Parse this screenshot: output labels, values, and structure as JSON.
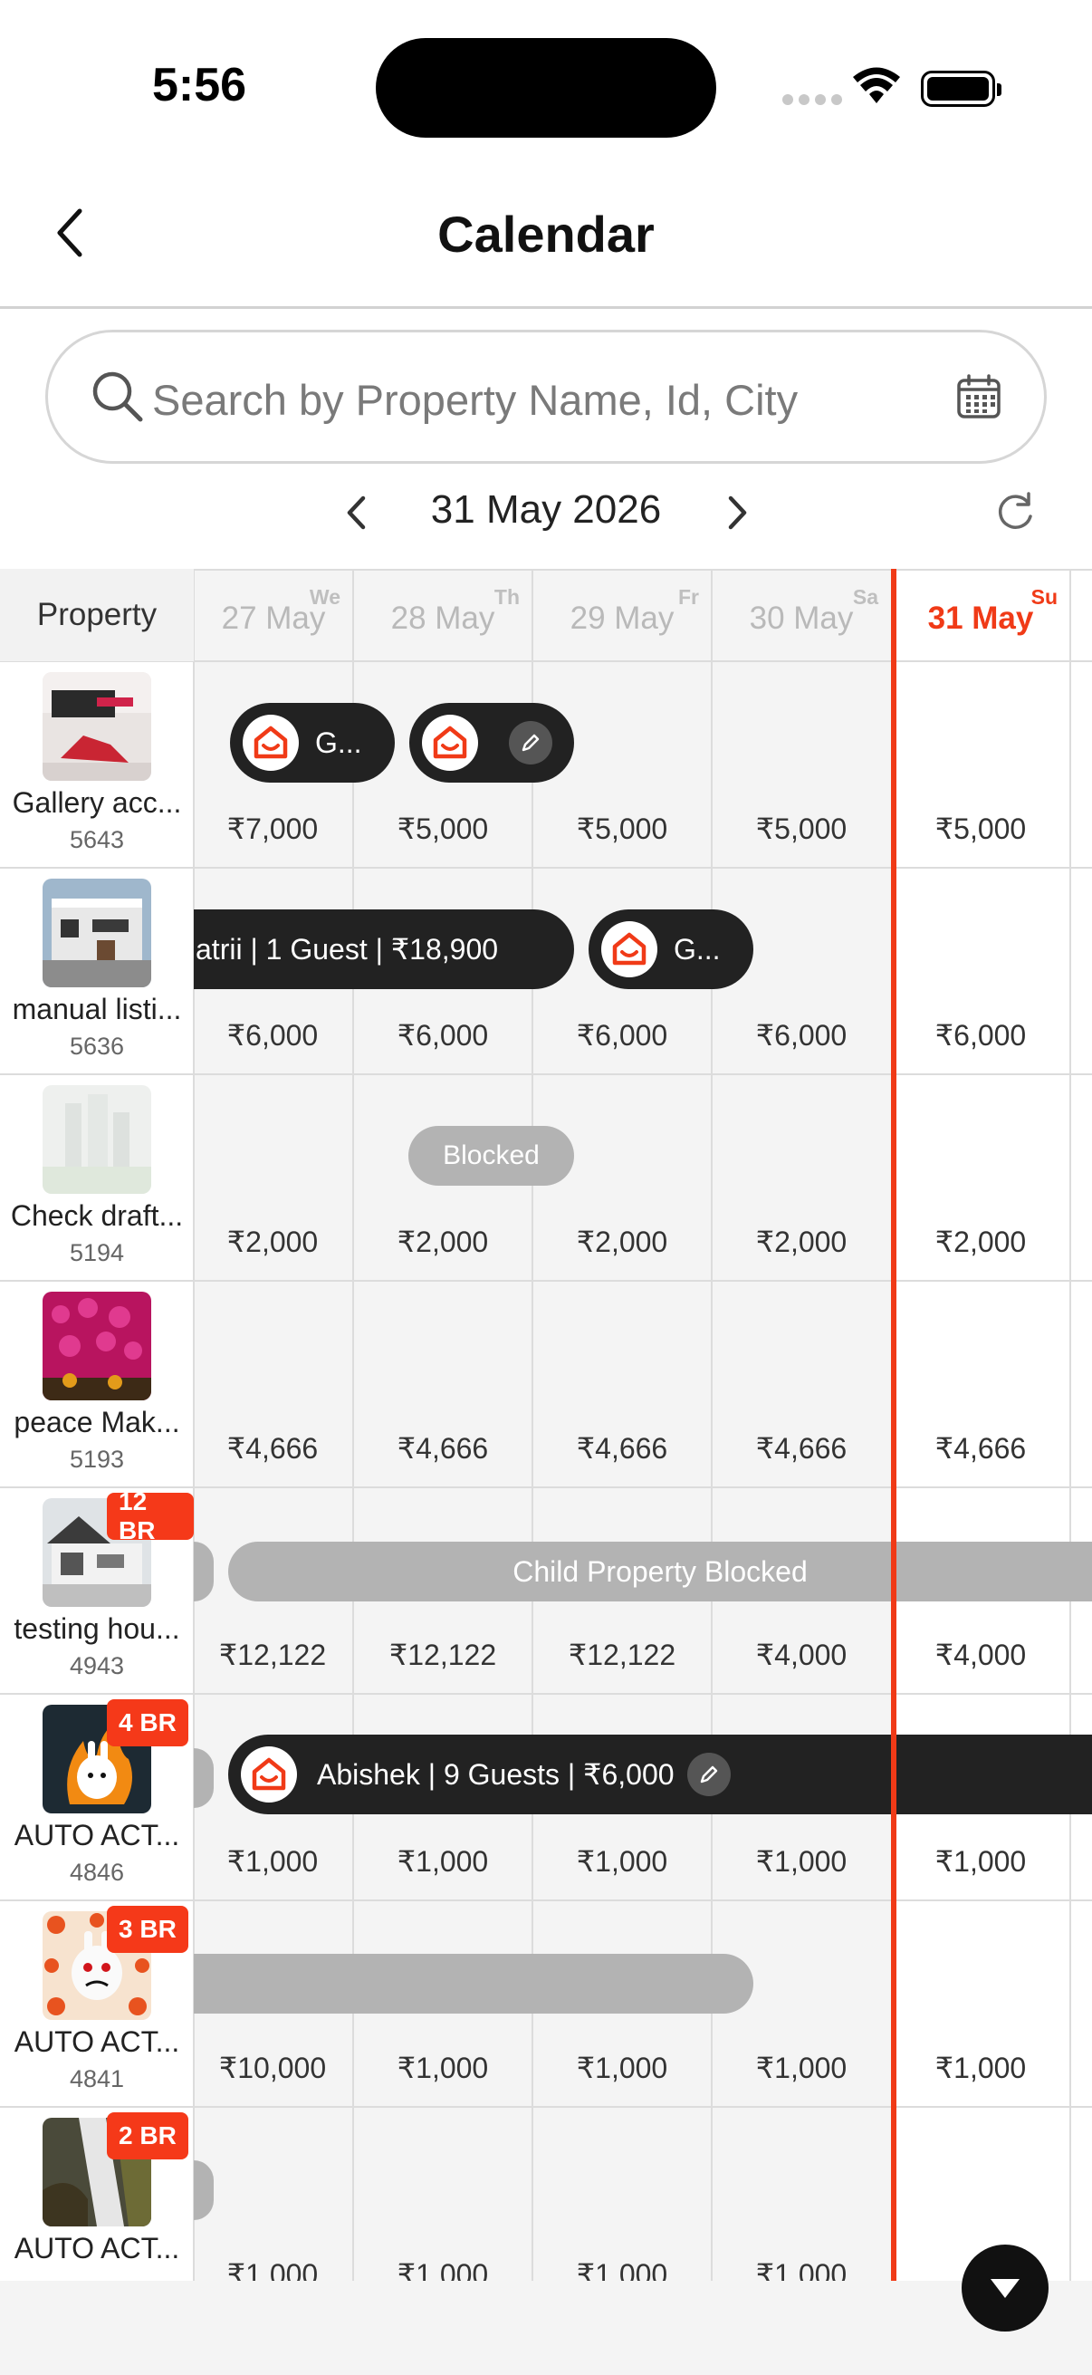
{
  "status": {
    "time": "5:56"
  },
  "header": {
    "title": "Calendar"
  },
  "search": {
    "placeholder": "Search by Property Name, Id, City",
    "value": ""
  },
  "date_nav": {
    "current": "31 May 2026"
  },
  "columns": {
    "property_header": "Property",
    "days": [
      {
        "weekday": "We",
        "date": "27 May"
      },
      {
        "weekday": "Th",
        "date": "28 May"
      },
      {
        "weekday": "Fr",
        "date": "29 May"
      },
      {
        "weekday": "Sa",
        "date": "30 May"
      },
      {
        "weekday": "Su",
        "date": "31 May"
      }
    ]
  },
  "properties": [
    {
      "name": "Gallery acc...",
      "id": "5643",
      "prices": [
        "₹7,000",
        "₹5,000",
        "₹5,000",
        "₹5,000",
        "₹5,000"
      ]
    },
    {
      "name": "manual listi...",
      "id": "5636",
      "prices": [
        "₹6,000",
        "₹6,000",
        "₹6,000",
        "₹6,000",
        "₹6,000"
      ]
    },
    {
      "name": "Check draft...",
      "id": "5194",
      "prices": [
        "₹2,000",
        "₹2,000",
        "₹2,000",
        "₹2,000",
        "₹2,000"
      ]
    },
    {
      "name": "peace Mak...",
      "id": "5193",
      "prices": [
        "₹4,666",
        "₹4,666",
        "₹4,666",
        "₹4,666",
        "₹4,666"
      ]
    },
    {
      "name": "testing hou...",
      "id": "4943",
      "badge": "12 BR",
      "prices": [
        "₹12,122",
        "₹12,122",
        "₹12,122",
        "₹4,000",
        "₹4,000"
      ]
    },
    {
      "name": "AUTO ACT...",
      "id": "4846",
      "badge": "4 BR",
      "prices": [
        "₹1,000",
        "₹1,000",
        "₹1,000",
        "₹1,000",
        "₹1,000"
      ]
    },
    {
      "name": "AUTO ACT...",
      "id": "4841",
      "badge": "3 BR",
      "prices": [
        "₹10,000",
        "₹1,000",
        "₹1,000",
        "₹1,000",
        "₹1,000"
      ]
    },
    {
      "name": "AUTO ACT...",
      "id": "",
      "badge": "2 BR",
      "prices": [
        "₹1,000",
        "₹1,000",
        "₹1,000",
        "₹1,000",
        ""
      ]
    }
  ],
  "bookings": {
    "row1_a": "G...",
    "row2_a": "atrii | 1 Guest | ₹18,900",
    "row2_b": "G...",
    "row3_blocked": "Blocked",
    "row5_child": "Child Property Blocked",
    "row6_booking": "Abishek | 9 Guests | ₹6,000"
  },
  "colors": {
    "accent": "#f03a17",
    "booking_pill": "#222222",
    "blocked_pill": "#b3b3b3"
  },
  "icons": [
    "back-icon",
    "search-icon",
    "calendar-icon",
    "chevron-left-icon",
    "chevron-right-icon",
    "refresh-icon",
    "home-logo-icon",
    "pencil-icon",
    "chevron-down-icon"
  ]
}
